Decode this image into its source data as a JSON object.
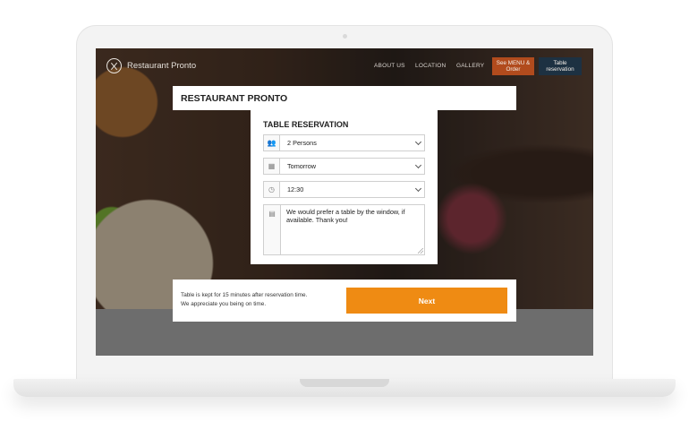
{
  "site": {
    "brand_name": "Restaurant Pronto",
    "nav": [
      "ABOUT US",
      "LOCATION",
      "GALLERY"
    ],
    "menu_button": "See MENU & Order",
    "reservation_button": "Table reservation"
  },
  "modal": {
    "title": "RESTAURANT PRONTO",
    "form_title": "TABLE RESERVATION",
    "persons": "2 Persons",
    "date": "Tomorrow",
    "time": "12:30",
    "note": "We would prefer a table by the window, if available. Thank you!",
    "footer_line1": "Table is kept for 15 minutes after reservation time.",
    "footer_line2": "We appreciate you being on time.",
    "next_label": "Next"
  },
  "colors": {
    "accent": "#ef8b13",
    "menu_button": "#b14b1d",
    "reservation_button": "#1d3142"
  },
  "icons": [
    "brand-logo-icon",
    "people-icon",
    "calendar-icon",
    "clock-icon",
    "note-icon",
    "chevron-down-icon"
  ]
}
